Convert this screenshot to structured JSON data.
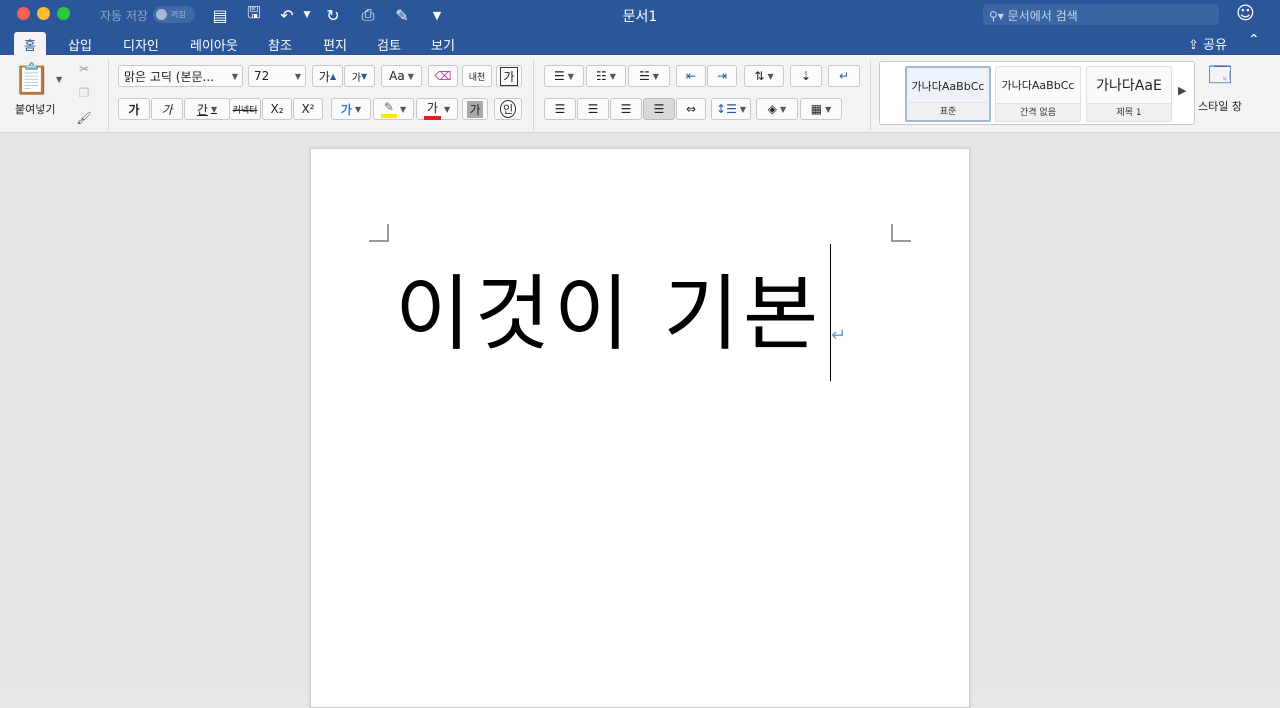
{
  "titlebar": {
    "autosave_label": "자동 저장",
    "autosave_state": "꺼짐",
    "title": "문서1",
    "search_placeholder": "문서에서 검색"
  },
  "tabs": [
    {
      "label": "홈",
      "active": true
    },
    {
      "label": "삽입"
    },
    {
      "label": "디자인"
    },
    {
      "label": "레이아웃"
    },
    {
      "label": "참조"
    },
    {
      "label": "편지"
    },
    {
      "label": "검토"
    },
    {
      "label": "보기"
    }
  ],
  "share_label": "공유",
  "clipboard": {
    "paste_label": "붙여넣기"
  },
  "font": {
    "name": "맑은 고딕 (본문...",
    "size": "72",
    "grow_label": "가",
    "shrink_label": "가",
    "case_label": "Aa",
    "bold_label": "가",
    "italic_label": "가",
    "underline_label": "간",
    "strike_label": "커넥터",
    "subscript_label": "X₂",
    "superscript_label": "X²",
    "text_effects_label": "가",
    "font_color_label": "가",
    "char_shade_label": "가",
    "enclose_label": "인",
    "phonetic_label": "내천",
    "char_border_label": "가"
  },
  "styles": [
    {
      "sample": "가나다AaBbCc",
      "name": "표준",
      "active": true
    },
    {
      "sample": "가나다AaBbCc",
      "name": "간격 없음"
    },
    {
      "sample": "가나다AaE",
      "name": "제목 1"
    }
  ],
  "styles_pane_label": "스타일 창",
  "document": {
    "text": "이것이 기본"
  },
  "colors": {
    "accent": "#2b579a",
    "font_color": "#e02020",
    "highlight": "#ffe600"
  }
}
